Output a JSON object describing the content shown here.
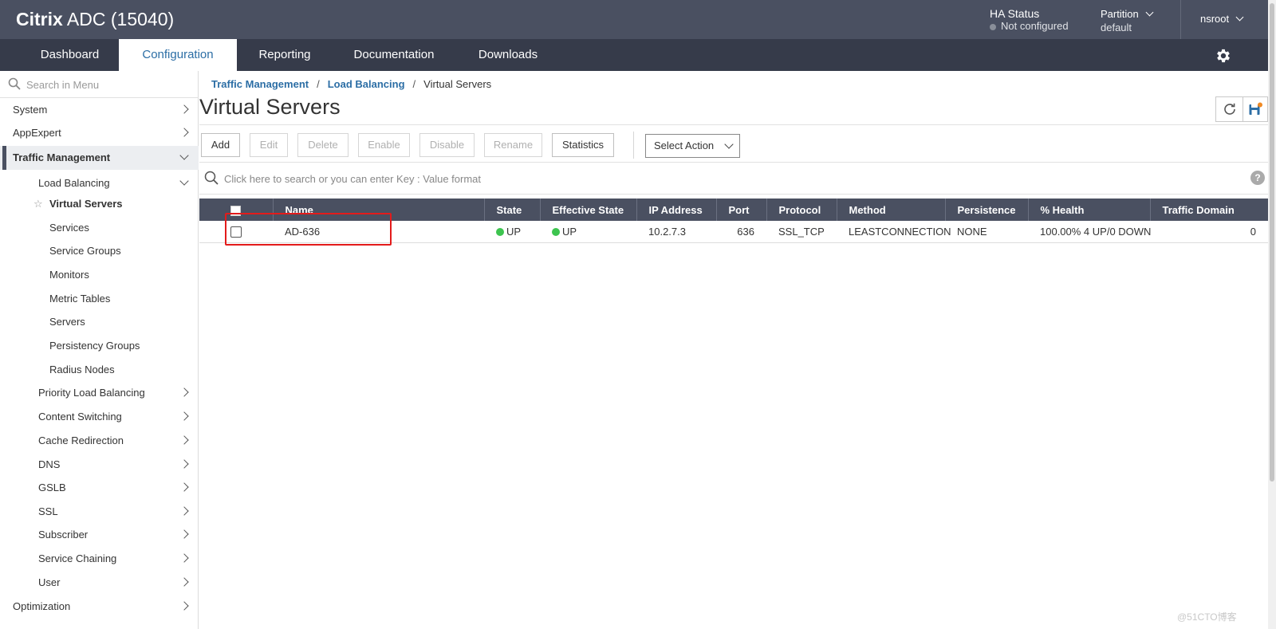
{
  "app": {
    "brand_bold": "Citrix",
    "brand_rest": "ADC (15040)"
  },
  "header": {
    "ha_title": "HA Status",
    "ha_status": "Not configured",
    "partition_label": "Partition",
    "partition_value": "default",
    "user": "nsroot"
  },
  "nav": {
    "tabs": [
      "Dashboard",
      "Configuration",
      "Reporting",
      "Documentation",
      "Downloads"
    ],
    "active": "Configuration"
  },
  "sidebar": {
    "search_placeholder": "Search in Menu",
    "items": [
      "System",
      "AppExpert",
      "Traffic Management",
      "Load Balancing",
      "Virtual Servers",
      "Services",
      "Service Groups",
      "Monitors",
      "Metric Tables",
      "Servers",
      "Persistency Groups",
      "Radius Nodes",
      "Priority Load Balancing",
      "Content Switching",
      "Cache Redirection",
      "DNS",
      "GSLB",
      "SSL",
      "Subscriber",
      "Service Chaining",
      "User",
      "Optimization"
    ]
  },
  "main": {
    "breadcrumb": [
      "Traffic Management",
      "Load Balancing",
      "Virtual Servers"
    ],
    "title": "Virtual Servers",
    "buttons": [
      "Add",
      "Edit",
      "Delete",
      "Enable",
      "Disable",
      "Rename",
      "Statistics"
    ],
    "select_action": "Select Action",
    "search_placeholder": "Click here to search or you can enter Key : Value format",
    "help": "?"
  },
  "table": {
    "columns": [
      "Name",
      "State",
      "Effective State",
      "IP Address",
      "Port",
      "Protocol",
      "Method",
      "Persistence",
      "% Health",
      "Traffic Domain"
    ],
    "rows": [
      [
        "AD-636",
        "UP",
        "UP",
        "10.2.7.3",
        "636",
        "SSL_TCP",
        "LEASTCONNECTION",
        "NONE",
        "100.00% 4 UP/0 DOWN",
        "0"
      ]
    ]
  },
  "watermark": "@51CTO博客",
  "colors": {
    "header_bg": "#4a5061",
    "nav_bg": "#363b4a",
    "link": "#2c6ea5",
    "up_green": "#3dc44f",
    "highlight_red": "#e31b1b"
  }
}
